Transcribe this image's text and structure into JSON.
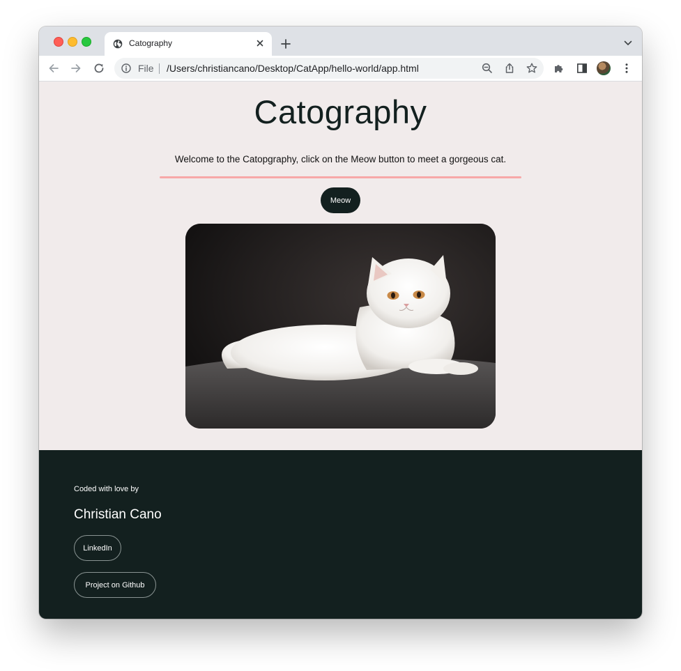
{
  "browser": {
    "tab": {
      "title": "Catography"
    },
    "address_bar": {
      "scheme_label": "File",
      "url": "/Users/christiancano/Desktop/CatApp/hello-world/app.html"
    },
    "icons": [
      "back-icon",
      "forward-icon",
      "reload-icon",
      "info-icon",
      "zoom-out-icon",
      "share-icon",
      "bookmark-star-icon",
      "extensions-icon",
      "side-panel-icon",
      "avatar",
      "menu-icon"
    ]
  },
  "page": {
    "heading": "Catography",
    "welcome_text": "Welcome to the Catopgraphy, click on the Meow button to meet a gorgeous cat.",
    "meow_button": "Meow",
    "colors": {
      "dark": "#13201f",
      "background": "#f1ebeb",
      "accent_line": "#f7a8a8"
    }
  },
  "footer": {
    "coded_with_love": "Coded with love by",
    "author": "Christian Cano",
    "links": {
      "linkedin": "LinkedIn",
      "github": "Project on Github"
    }
  }
}
